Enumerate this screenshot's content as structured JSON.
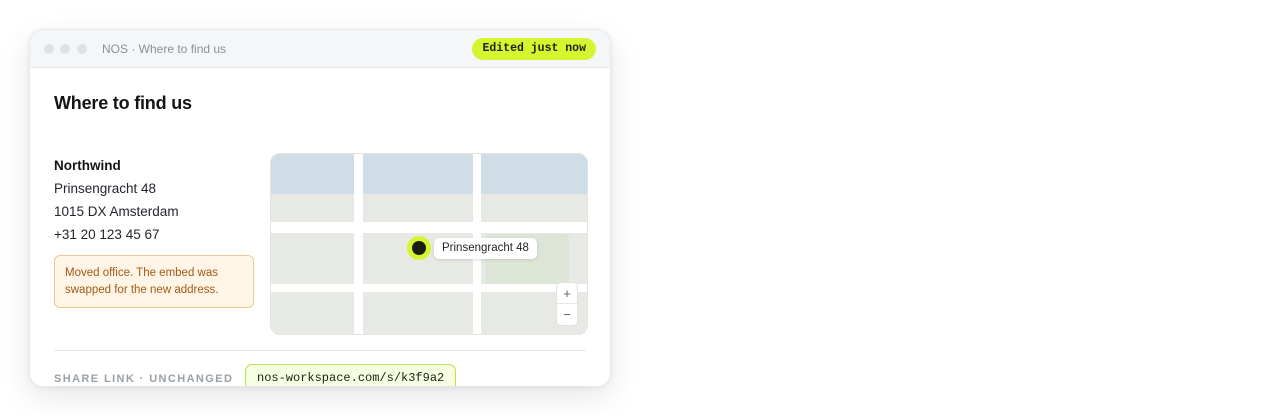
{
  "window": {
    "title": "NOS · Where to find us",
    "status": "Edited just now"
  },
  "page": {
    "heading": "Where to find us"
  },
  "address": {
    "name": "Northwind",
    "street": "Prinsengracht 48",
    "city": "1015 DX Amsterdam",
    "phone": "+31 20 123 45 67"
  },
  "note": {
    "text": "Moved office. The embed was swapped for the new address."
  },
  "map": {
    "pin_label": "Prinsengracht 48",
    "zoom_in_label": "+",
    "zoom_out_label": "−"
  },
  "share": {
    "label": "SHARE LINK · UNCHANGED",
    "url": "nos-workspace.com/s/k3f9a2"
  },
  "colors": {
    "accent": "#d5f531",
    "note_text": "#a35a12",
    "note_background": "#fff5e7",
    "link_background": "#f6fde0"
  }
}
